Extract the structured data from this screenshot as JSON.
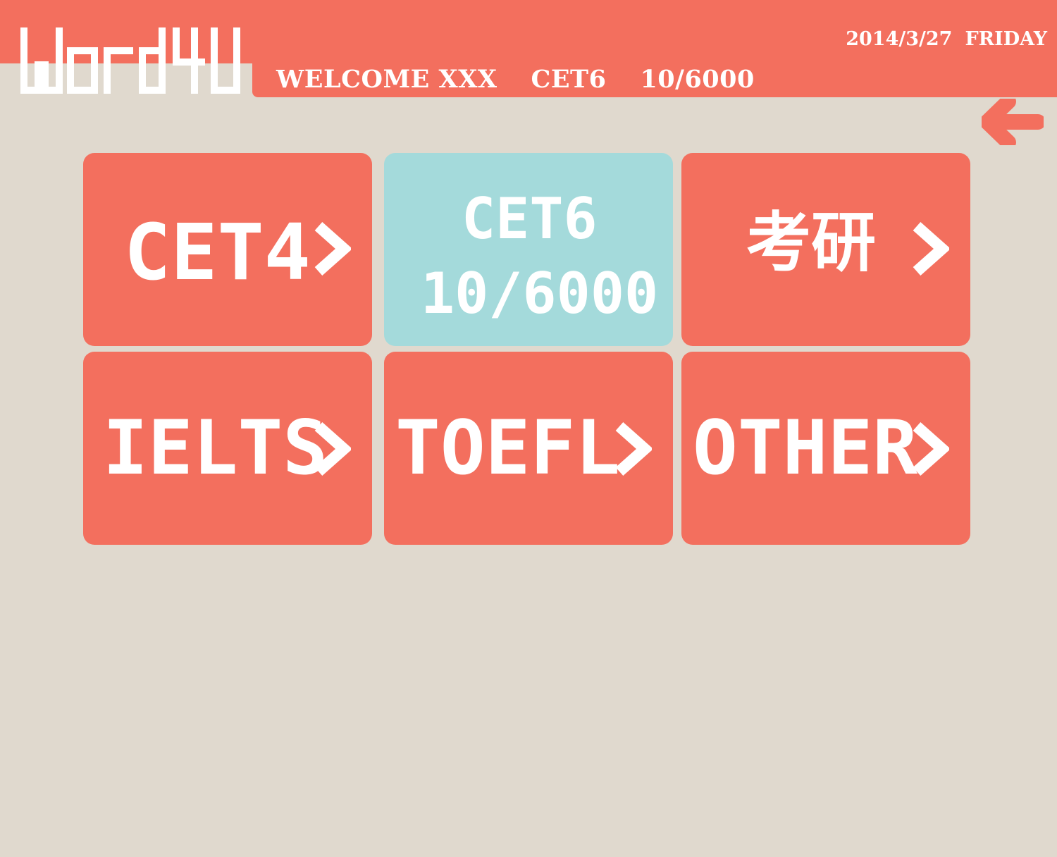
{
  "app": {
    "logo_text": "Word4U",
    "brand_color": "#f36f5e",
    "active_color": "#a4dadb",
    "background_color": "#e0d9ce"
  },
  "header": {
    "welcome": "WELCOME XXX",
    "current_book": "CET6",
    "progress": "10/6000",
    "date": "2014/3/27",
    "weekday": "FRIDAY",
    "back_icon": "arrow-left-icon"
  },
  "tiles": [
    {
      "label": "CET4",
      "chevron_icon": "chevron-right-icon"
    },
    {
      "label": "CET6",
      "progress": "10/6000"
    },
    {
      "label": "考研",
      "chevron_icon": "chevron-right-icon"
    },
    {
      "label": "IELTS",
      "chevron_icon": "chevron-right-icon"
    },
    {
      "label": "TOEFL",
      "chevron_icon": "chevron-right-icon"
    },
    {
      "label": "OTHER",
      "chevron_icon": "chevron-right-icon"
    }
  ]
}
